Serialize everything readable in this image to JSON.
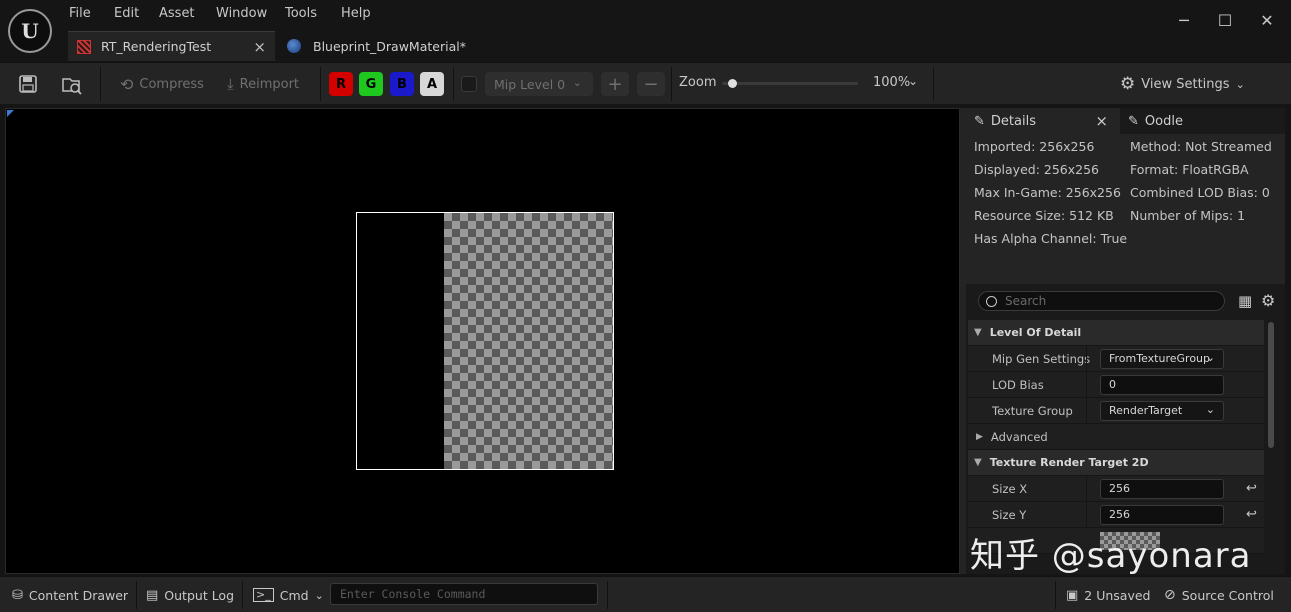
{
  "menu": [
    "File",
    "Edit",
    "Asset",
    "Window",
    "Tools",
    "Help"
  ],
  "window_controls": {
    "minimize": "─",
    "maximize": "☐",
    "close": "✕"
  },
  "tabs": [
    {
      "label": "RT_RenderingTest",
      "close": "×"
    },
    {
      "label": "Blueprint_DrawMaterial*"
    }
  ],
  "toolbar": {
    "compress": "Compress",
    "reimport": "Reimport",
    "channels": [
      {
        "label": "R",
        "color": "#d40000"
      },
      {
        "label": "G",
        "color": "#1ec81e"
      },
      {
        "label": "B",
        "color": "#1a1acc"
      },
      {
        "label": "A",
        "color": "#d8d8d8"
      }
    ],
    "mip_level": "Mip Level 0",
    "plus": "+",
    "minus": "−",
    "zoom_label": "Zoom",
    "zoom_value": "100%",
    "view_settings": "View Settings"
  },
  "details": {
    "tab_details": "Details",
    "tab_close": "×",
    "tab_oodle": "Oodle",
    "info_left": [
      "Imported: 256x256",
      "Displayed: 256x256",
      "Max In-Game: 256x256",
      "Resource Size: 512 KB",
      "Has Alpha Channel: True"
    ],
    "info_right": [
      "Method: Not Streamed",
      "Format: FloatRGBA",
      "Combined LOD Bias: 0",
      "Number of Mips: 1"
    ],
    "search_placeholder": "Search",
    "sections": {
      "lod": "Level Of Detail",
      "advanced": "Advanced",
      "trt": "Texture Render Target 2D"
    },
    "props": {
      "mip_gen": {
        "label": "Mip Gen Settings",
        "value": "FromTextureGroup"
      },
      "lod_bias": {
        "label": "LOD Bias",
        "value": "0"
      },
      "texture_group": {
        "label": "Texture Group",
        "value": "RenderTarget"
      },
      "size_x": {
        "label": "Size X",
        "value": "256"
      },
      "size_y": {
        "label": "Size Y",
        "value": "256"
      }
    }
  },
  "statusbar": {
    "content_drawer": "Content Drawer",
    "output_log": "Output Log",
    "cmd": "Cmd",
    "console_placeholder": "Enter Console Command",
    "unsaved": "2 Unsaved",
    "source_control": "Source Control"
  },
  "watermark": "知乎 @sayonara"
}
